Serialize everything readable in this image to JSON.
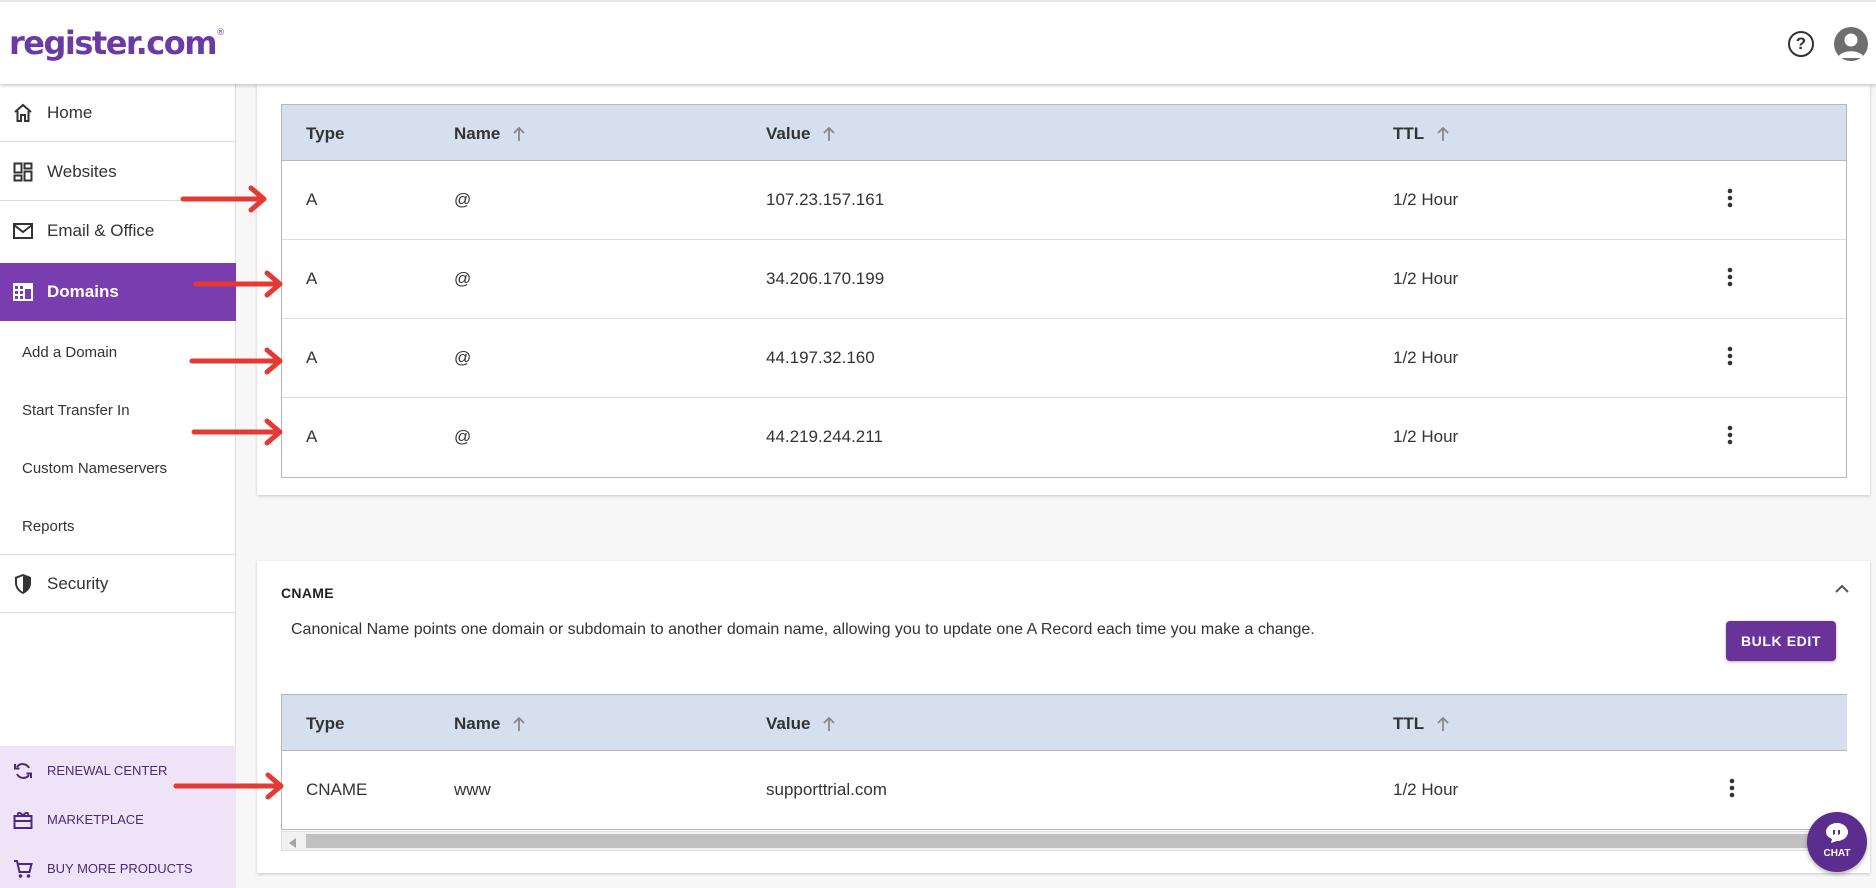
{
  "header": {
    "logo_text": "register.com",
    "logo_mark": "®",
    "help_icon": "help-circle-icon",
    "account_icon": "account-icon"
  },
  "sidebar": {
    "items": [
      {
        "label": "Home",
        "icon": "home-icon"
      },
      {
        "label": "Websites",
        "icon": "dashboard-icon"
      },
      {
        "label": "Email & Office",
        "icon": "mail-icon"
      },
      {
        "label": "Domains",
        "icon": "domains-icon",
        "active": true
      },
      {
        "label": "Security",
        "icon": "shield-icon"
      }
    ],
    "domain_subitems": [
      "Add a Domain",
      "Start Transfer In",
      "Custom Nameservers",
      "Reports"
    ],
    "promos": [
      {
        "label": "RENEWAL CENTER",
        "icon": "renew-icon"
      },
      {
        "label": "MARKETPLACE",
        "icon": "gift-icon"
      },
      {
        "label": "BUY MORE PRODUCTS",
        "icon": "cart-icon"
      }
    ]
  },
  "a_records": {
    "columns": [
      "Type",
      "Name",
      "Value",
      "TTL"
    ],
    "rows": [
      {
        "type": "A",
        "name": "@",
        "value": "107.23.157.161",
        "ttl": "1/2 Hour"
      },
      {
        "type": "A",
        "name": "@",
        "value": "34.206.170.199",
        "ttl": "1/2 Hour"
      },
      {
        "type": "A",
        "name": "@",
        "value": "44.197.32.160",
        "ttl": "1/2 Hour"
      },
      {
        "type": "A",
        "name": "@",
        "value": "44.219.244.211",
        "ttl": "1/2 Hour"
      }
    ]
  },
  "cname": {
    "title": "CNAME",
    "description": "Canonical Name points one domain or subdomain to another domain name, allowing you to update one A Record each time you make a change.",
    "bulk_edit_label": "BULK EDIT",
    "columns": [
      "Type",
      "Name",
      "Value",
      "TTL"
    ],
    "rows": [
      {
        "type": "CNAME",
        "name": "www",
        "value": "supporttrial.com",
        "ttl": "1/2 Hour"
      }
    ]
  },
  "chat": {
    "label": "CHAT"
  },
  "colors": {
    "brand": "#6b3aa5",
    "active_nav": "#7a3db0",
    "table_header": "#d5dfee",
    "annotation_arrow": "#e53935"
  }
}
